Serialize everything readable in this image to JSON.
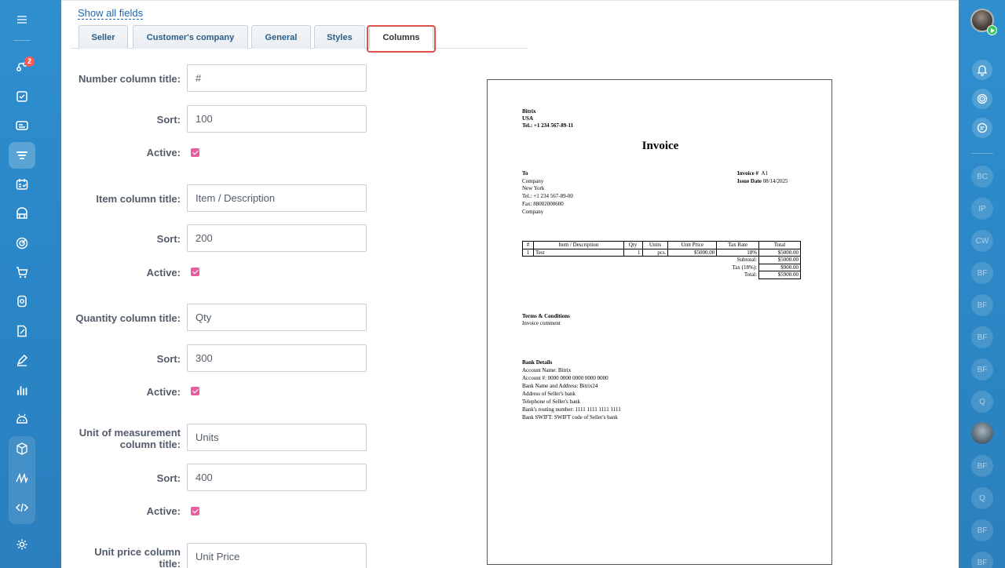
{
  "tabs": {
    "show_all": "Show all fields",
    "items": [
      {
        "label": "Seller"
      },
      {
        "label": "Customer's company"
      },
      {
        "label": "General"
      },
      {
        "label": "Styles"
      },
      {
        "label": "Columns"
      }
    ]
  },
  "left_nav": {
    "badge": "2"
  },
  "right_nav": {
    "avatars": [
      "BC",
      "IP",
      "CW",
      "BF",
      "BF",
      "BF",
      "BF",
      "Q",
      "BF",
      "Q",
      "BF",
      "BF"
    ]
  },
  "form": {
    "number": {
      "title_label": "Number column title:",
      "title_value": "#",
      "sort_label": "Sort:",
      "sort_value": "100",
      "active_label": "Active:"
    },
    "item": {
      "title_label": "Item column title:",
      "title_value": "Item / Description",
      "sort_label": "Sort:",
      "sort_value": "200",
      "active_label": "Active:"
    },
    "quantity": {
      "title_label": "Quantity column title:",
      "title_value": "Qty",
      "sort_label": "Sort:",
      "sort_value": "300",
      "active_label": "Active:"
    },
    "units": {
      "title_label_1": "Unit of measurement",
      "title_label_2": "column title:",
      "title_value": "Units",
      "sort_label": "Sort:",
      "sort_value": "400",
      "active_label": "Active:"
    },
    "unit_price": {
      "title_label_1": "Unit price column",
      "title_label_2": "title:",
      "title_value": "Unit Price"
    }
  },
  "invoice": {
    "seller": [
      "Bitrix",
      "USA",
      "Tel.: +1 234 567-89-11"
    ],
    "title": "Invoice",
    "to_label": "To",
    "to_lines": [
      "Company",
      "New York",
      "Tel.: +1 234 567-89-00",
      "Fax: 88002000600",
      "Company"
    ],
    "invoice_no_label": "Invoice #",
    "invoice_no": "A1",
    "issue_date_label": "Issue Date",
    "issue_date": "08/14/2025",
    "table": {
      "headers": [
        "#",
        "Item / Description",
        "Qty",
        "Units",
        "Unit Price",
        "Tax Rate",
        "Total"
      ],
      "rows": [
        [
          "1",
          "Test",
          "1",
          "pcs.",
          "$5000.00",
          "18%",
          "$5000.00"
        ]
      ],
      "subtotal_label": "Subtotal:",
      "subtotal": "$5000.00",
      "tax_label": "Tax (18%):",
      "tax": "$900.00",
      "total_label": "Total:",
      "total": "$5900.00"
    },
    "terms_title": "Terms & Conditions",
    "terms_text": "Invoice comment",
    "bank_title": "Bank Details",
    "bank_lines": [
      "Account Name: Bitrix",
      "Account #: 0000 0000 0000 0000 0000",
      "Bank Name and Address: Bitrix24",
      "Address of Seller's bank",
      "Telephone of Seller's bank",
      "Bank's routing number: 1111 1111 1111 1111",
      "Bank SWIFT: SWIFT code of Seller's bank"
    ]
  }
}
